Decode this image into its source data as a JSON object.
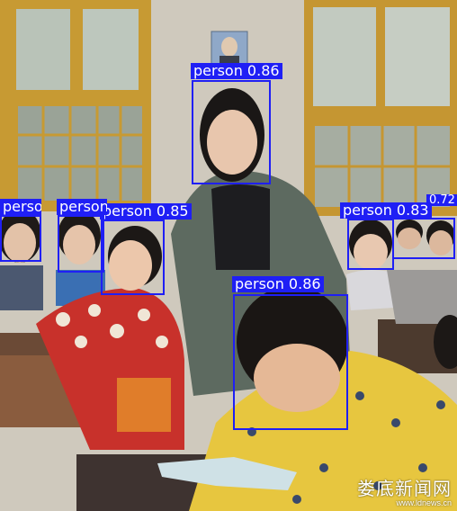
{
  "detections": [
    {
      "label": "person 0.86",
      "id": "teacher"
    },
    {
      "label": "person 0.86",
      "id": "front-girl"
    },
    {
      "label": "person 0.85",
      "id": "girl-glasses-left"
    },
    {
      "label": "person",
      "id": "girl-far-left"
    },
    {
      "label": "person",
      "id": "girl-second-left"
    },
    {
      "label": "person 0.83",
      "id": "girl-glasses-right"
    },
    {
      "label": "0.72",
      "id": "boy-far-right"
    }
  ],
  "watermark": {
    "name": "娄底新闻网",
    "url": "www.ldnews.cn"
  },
  "colors": {
    "box": "#1f1ff5",
    "label_text": "#ffffff"
  }
}
